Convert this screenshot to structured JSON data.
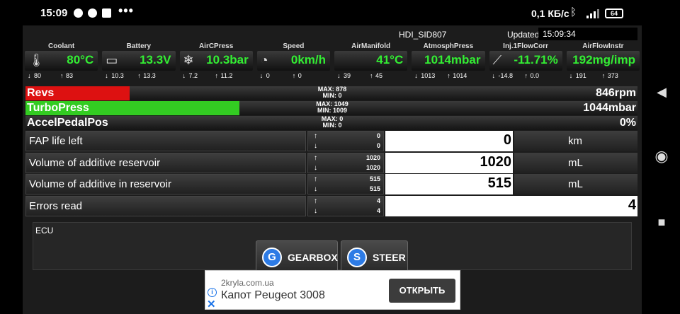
{
  "status_bar": {
    "time": "15:09",
    "net_speed": "0,1 КБ/с",
    "battery": "64",
    "icons": [
      "telegram-icon",
      "chrome-icon",
      "chrome-icon",
      "news-icon",
      "more-dots-icon",
      "bluetooth-icon",
      "signal-4g-icon",
      "battery-icon"
    ]
  },
  "header": {
    "profile": "HDI_SID807",
    "updated_label": "Updated:",
    "updated_time": "15:09:34"
  },
  "gauges": [
    {
      "label": "Coolant",
      "value": "80°C",
      "min": "80",
      "max": "83",
      "icon": "thermometer-icon"
    },
    {
      "label": "Battery",
      "value": "13.3V",
      "min": "10.3",
      "max": "13.3",
      "icon": "battery-car-icon"
    },
    {
      "label": "AirCPress",
      "value": "10.3bar",
      "min": "7.2",
      "max": "11.2",
      "icon": "snowflake-icon"
    },
    {
      "label": "Speed",
      "value": "0km/h",
      "min": "0",
      "max": "0",
      "icon": "speedometer-icon"
    },
    {
      "label": "AirManifold",
      "value": "41°C",
      "min": "39",
      "max": "45",
      "icon": ""
    },
    {
      "label": "AtmosphPress",
      "value": "1014mbar",
      "min": "1013",
      "max": "1014",
      "icon": ""
    },
    {
      "label": "Inj.1FlowCorr",
      "value": "-11.71%",
      "min": "-14.8",
      "max": "0.0",
      "icon": "injector-icon"
    },
    {
      "label": "AirFlowInstr",
      "value": "192mg/imp",
      "min": "191",
      "max": "373",
      "icon": ""
    }
  ],
  "bars": [
    {
      "label": "Revs",
      "max": "MAX: 878",
      "min": "MIN: 0",
      "value": "846rpm",
      "fill": 0.17,
      "color": "#dd1111"
    },
    {
      "label": "TurboPress",
      "max": "MAX: 1049",
      "min": "MIN: 1009",
      "value": "1044mbar",
      "fill": 0.35,
      "color": "#33cc22"
    },
    {
      "label": "AccelPedalPos",
      "max": "MAX: 0",
      "min": "MIN: 0",
      "value": "0%",
      "fill": 0.0,
      "color": "#33cc22"
    }
  ],
  "params": [
    {
      "name": "FAP life left",
      "up": "0",
      "down": "0",
      "value": "0",
      "unit": "km"
    },
    {
      "name": "Volume of additive reservoir",
      "up": "1020",
      "down": "1020",
      "value": "1020",
      "unit": "mL"
    },
    {
      "name": "Volume of additive in reservoir",
      "up": "515",
      "down": "515",
      "value": "515",
      "unit": "mL"
    },
    {
      "name": "Errors read",
      "up": "4",
      "down": "4",
      "value": "4",
      "unit": ""
    }
  ],
  "ecu": {
    "label": "ECU",
    "buttons": [
      {
        "letter": "G",
        "label": "GEARBOX"
      },
      {
        "letter": "S",
        "label": "STEER"
      }
    ]
  },
  "ad": {
    "url": "2kryla.com.ua",
    "title": "Капот Peugeot 3008",
    "button": "ОТКРЫТЬ"
  },
  "arrows": {
    "up": "↑",
    "down": "↓"
  },
  "nav_icons": [
    "back-icon",
    "home-icon",
    "recents-icon"
  ]
}
